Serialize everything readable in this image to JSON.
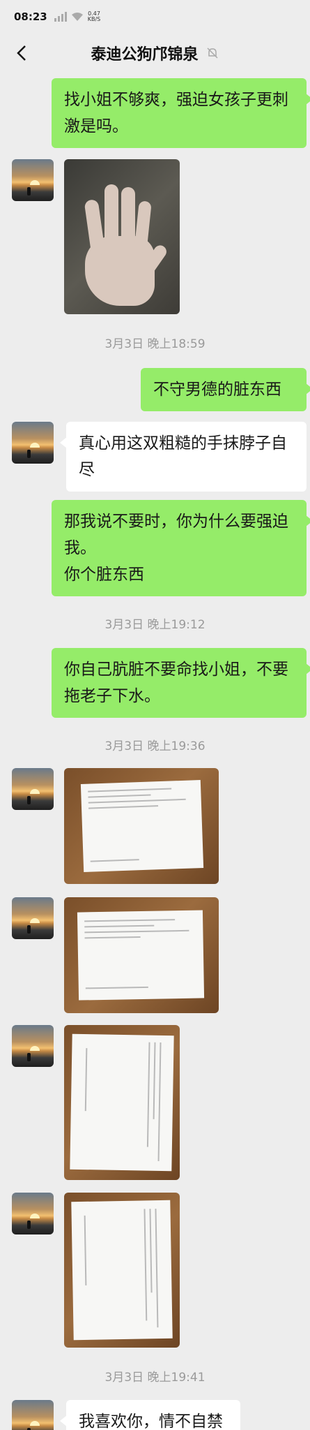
{
  "status_bar": {
    "time": "08:23",
    "net_speed": "0.47",
    "net_unit": "KB/S"
  },
  "header": {
    "title": "泰迪公狗邝锦泉",
    "back_icon": "chevron-left-icon",
    "mute_icon": "bell-muted-icon"
  },
  "messages": [
    {
      "kind": "text",
      "sender": "me",
      "text": "找小姐不够爽，强迫女孩子更刺激是吗。"
    },
    {
      "kind": "image",
      "sender": "them",
      "description_icon": "hand-photo"
    },
    {
      "kind": "time",
      "text": "3月3日 晚上18:59"
    },
    {
      "kind": "text",
      "sender": "me",
      "text": "不守男德的脏东西"
    },
    {
      "kind": "text",
      "sender": "them",
      "text": "真心用这双粗糙的手抹脖子自尽"
    },
    {
      "kind": "text",
      "sender": "me",
      "line1": "那我说不要时，你为什么要强迫我。",
      "line2": "你个脏东西"
    },
    {
      "kind": "time",
      "text": "3月3日 晚上19:12"
    },
    {
      "kind": "text",
      "sender": "me",
      "text": "你自己肮脏不要命找小姐，不要拖老子下水。"
    },
    {
      "kind": "time",
      "text": "3月3日 晚上19:36"
    },
    {
      "kind": "image",
      "sender": "them",
      "description_icon": "document-photo"
    },
    {
      "kind": "image",
      "sender": "them",
      "description_icon": "document-photo"
    },
    {
      "kind": "image",
      "sender": "them",
      "description_icon": "document-photo"
    },
    {
      "kind": "image",
      "sender": "them",
      "description_icon": "document-photo"
    },
    {
      "kind": "time",
      "text": "3月3日 晚上19:41"
    },
    {
      "kind": "text",
      "sender": "them",
      "text": "我喜欢你，情不自禁"
    }
  ],
  "colors": {
    "me_bubble": "#95ec69",
    "them_bubble": "#ffffff",
    "background": "#ededed"
  }
}
